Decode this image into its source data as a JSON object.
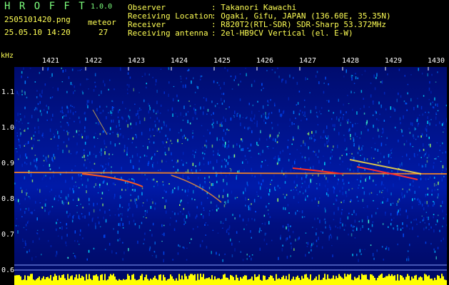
{
  "app": {
    "title": "H R O F F T",
    "version": "1.0.0",
    "filename": "2505101420.png",
    "datetime": "25.05.10 14:20",
    "meteor_label": "meteor",
    "meteor_count": "27"
  },
  "info": {
    "rows": [
      {
        "label": "Observer",
        "value": ": Takanori Kawachi"
      },
      {
        "label": "Receiving Location",
        "value": ": Ogaki, Gifu, JAPAN (136.60E, 35.35N)"
      },
      {
        "label": "Receiver",
        "value": ": R820T2(RTL-SDR) SDR-Sharp 53.372MHz"
      },
      {
        "label": "Receiving antenna",
        "value": ": 2el-HB9CV Vertical (el. E-W)"
      }
    ]
  },
  "axes": {
    "y_unit": "kHz",
    "y_ticks": [
      "1.1",
      "1.0",
      "0.9",
      "0.8",
      "0.7",
      "0.6"
    ],
    "x_ticks": [
      "1421",
      "1422",
      "1423",
      "1424",
      "1425",
      "1426",
      "1427",
      "1428",
      "1429",
      "1430"
    ]
  },
  "colors": {
    "background": "#000000",
    "title": "#7dff7d",
    "label": "#ffff55",
    "tick_text": "#ffffff",
    "spectrum_low": "#00108a",
    "spectrum_mid": "#00c8ff",
    "spectrum_high": "#ffff00",
    "signal": "#ff3030"
  }
}
